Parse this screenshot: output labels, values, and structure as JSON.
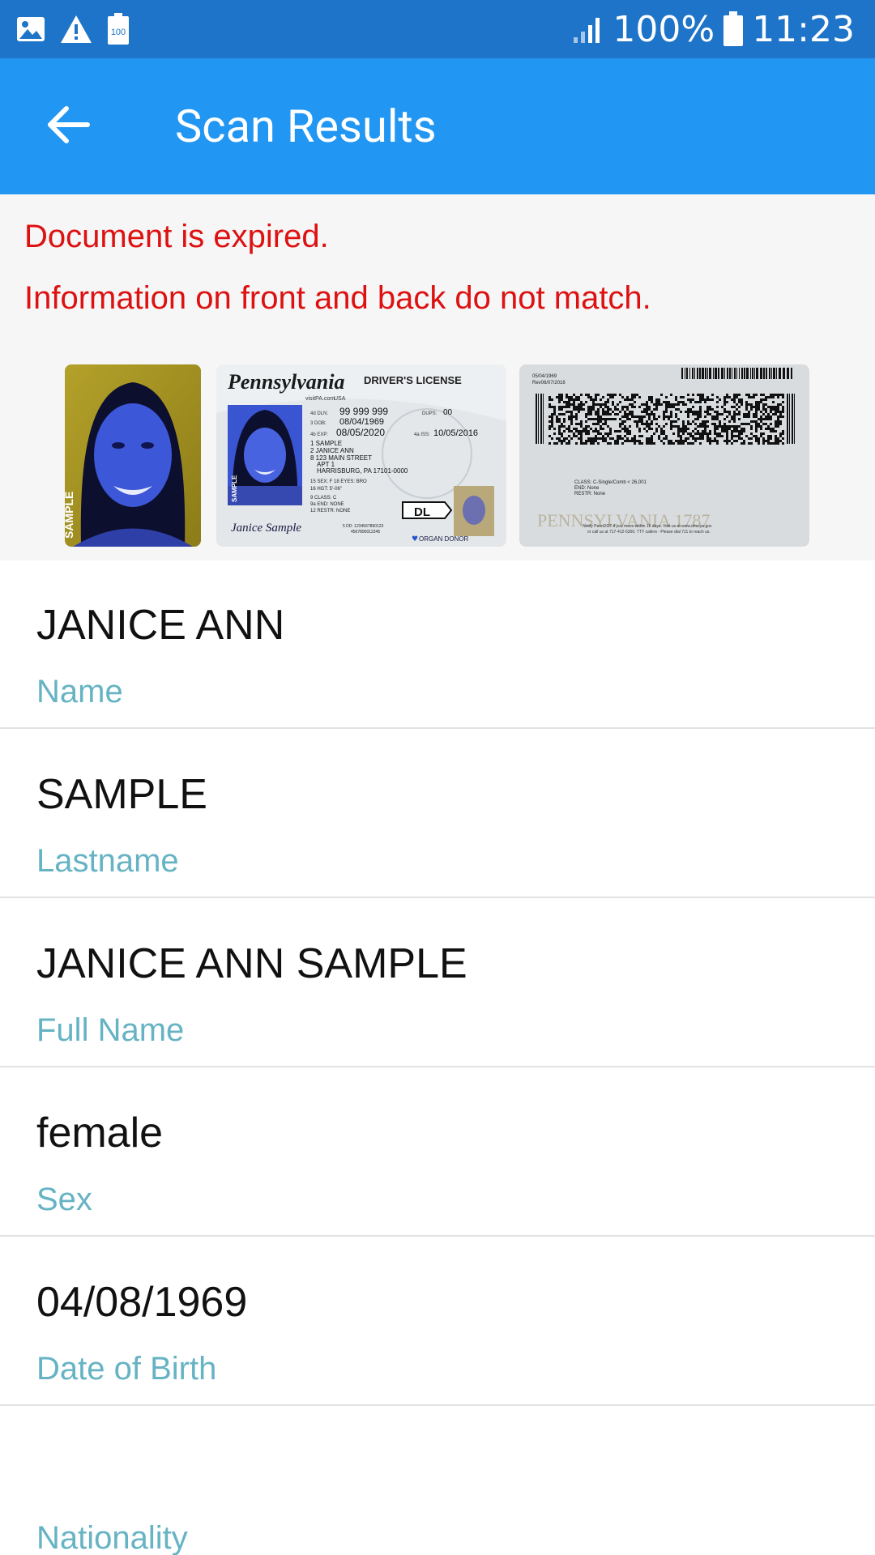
{
  "status_bar": {
    "battery_percent": "100%",
    "time": "11:23",
    "left_icons": [
      "image-icon",
      "warning-icon",
      "battery-saver-icon"
    ],
    "battery_saver_text": "100"
  },
  "app_bar": {
    "title": "Scan Results",
    "back_icon": "arrow-left-icon",
    "color": "#2196f3"
  },
  "alerts": {
    "expired": "Document is expired.",
    "mismatch": "Information on front and back do not match.",
    "color": "#dd1111"
  },
  "document_images": {
    "front": {
      "state": "Pennsylvania",
      "site": "visitPA.com",
      "country": "USA",
      "type": "DRIVER'S LICENSE",
      "dln_label": "4d DLN:",
      "dln": "99 999 999",
      "dups_label": "DUPS:",
      "dups": "00",
      "dob_label": "3 DOB:",
      "dob": "08/04/1969",
      "exp_label": "4b EXP:",
      "exp": "08/05/2020",
      "iss_label": "4a ISS:",
      "iss": "10/05/2016",
      "name_lines": [
        "1 SAMPLE",
        "2 JANICE ANN",
        "8 123 MAIN STREET",
        "APT 1",
        "HARRISBURG, PA 17101-0000"
      ],
      "sex_line": "15 SEX: F   18 EYES: BRO",
      "hgt_line": "16 HGT: 5'-06\"",
      "class_line": "9 CLASS: C",
      "end_line": "9a END: NONE",
      "restr_line": "12 RESTR: NONE",
      "dd_line": "5 DD: 1234567890123",
      "dd_line2": "4567890012345",
      "badge": "DL",
      "donor": "ORGAN DONOR",
      "signature": "Janice Sample",
      "sample_mark": "SAMPLE"
    },
    "back": {
      "date1": "05/04/1969",
      "rev": "Rev06/07/2016",
      "class_line": "CLASS: C-Single/Comb < 26,001",
      "end_line": "END: None",
      "restr_line": "RESTR: None",
      "watermark": "PENNSYLVANIA 1787",
      "notice1": "Notify PennDOT if you move within 15 days. Visit us at www.dmv.pa.gov",
      "notice2": "or call us at 717-412-5300. TTY callers - Please dial 711 to reach us."
    },
    "photo": {
      "sample_mark": "SAMPLE"
    }
  },
  "fields": [
    {
      "value": "JANICE ANN",
      "label": "Name"
    },
    {
      "value": "SAMPLE",
      "label": "Lastname"
    },
    {
      "value": "JANICE ANN SAMPLE",
      "label": "Full Name"
    },
    {
      "value": "female",
      "label": "Sex"
    },
    {
      "value": "04/08/1969",
      "label": "Date of Birth"
    },
    {
      "value": "",
      "label": "Nationality"
    }
  ]
}
